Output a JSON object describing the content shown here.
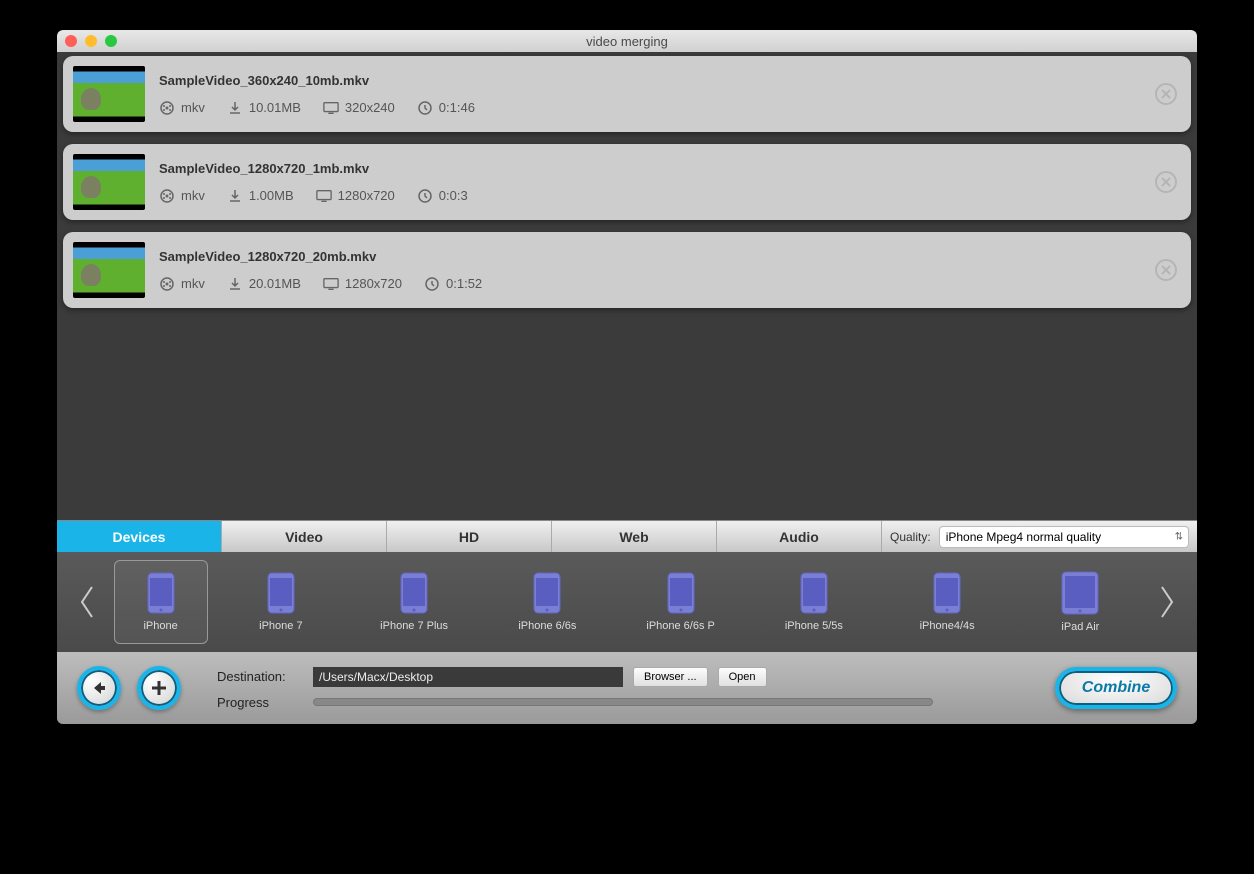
{
  "window": {
    "title": "video merging"
  },
  "videos": [
    {
      "name": "SampleVideo_360x240_10mb.mkv",
      "format": "mkv",
      "size": "10.01MB",
      "resolution": "320x240",
      "duration": "0:1:46"
    },
    {
      "name": "SampleVideo_1280x720_1mb.mkv",
      "format": "mkv",
      "size": "1.00MB",
      "resolution": "1280x720",
      "duration": "0:0:3"
    },
    {
      "name": "SampleVideo_1280x720_20mb.mkv",
      "format": "mkv",
      "size": "20.01MB",
      "resolution": "1280x720",
      "duration": "0:1:52"
    }
  ],
  "tabs": {
    "items": [
      "Devices",
      "Video",
      "HD",
      "Web",
      "Audio"
    ],
    "active": 0
  },
  "quality": {
    "label": "Quality:",
    "selected": "iPhone Mpeg4 normal quality"
  },
  "devices": [
    {
      "label": "iPhone",
      "type": "phone",
      "selected": true
    },
    {
      "label": "iPhone 7",
      "type": "phone"
    },
    {
      "label": "iPhone 7 Plus",
      "type": "phone"
    },
    {
      "label": "iPhone 6/6s",
      "type": "phone"
    },
    {
      "label": "iPhone 6/6s P",
      "type": "phone"
    },
    {
      "label": "iPhone 5/5s",
      "type": "phone"
    },
    {
      "label": "iPhone4/4s",
      "type": "phone"
    },
    {
      "label": "iPad Air",
      "type": "tablet"
    }
  ],
  "bottom": {
    "destination_label": "Destination:",
    "destination_value": "/Users/Macx/Desktop",
    "browser_label": "Browser ...",
    "open_label": "Open",
    "progress_label": "Progress",
    "combine_label": "Combine"
  }
}
